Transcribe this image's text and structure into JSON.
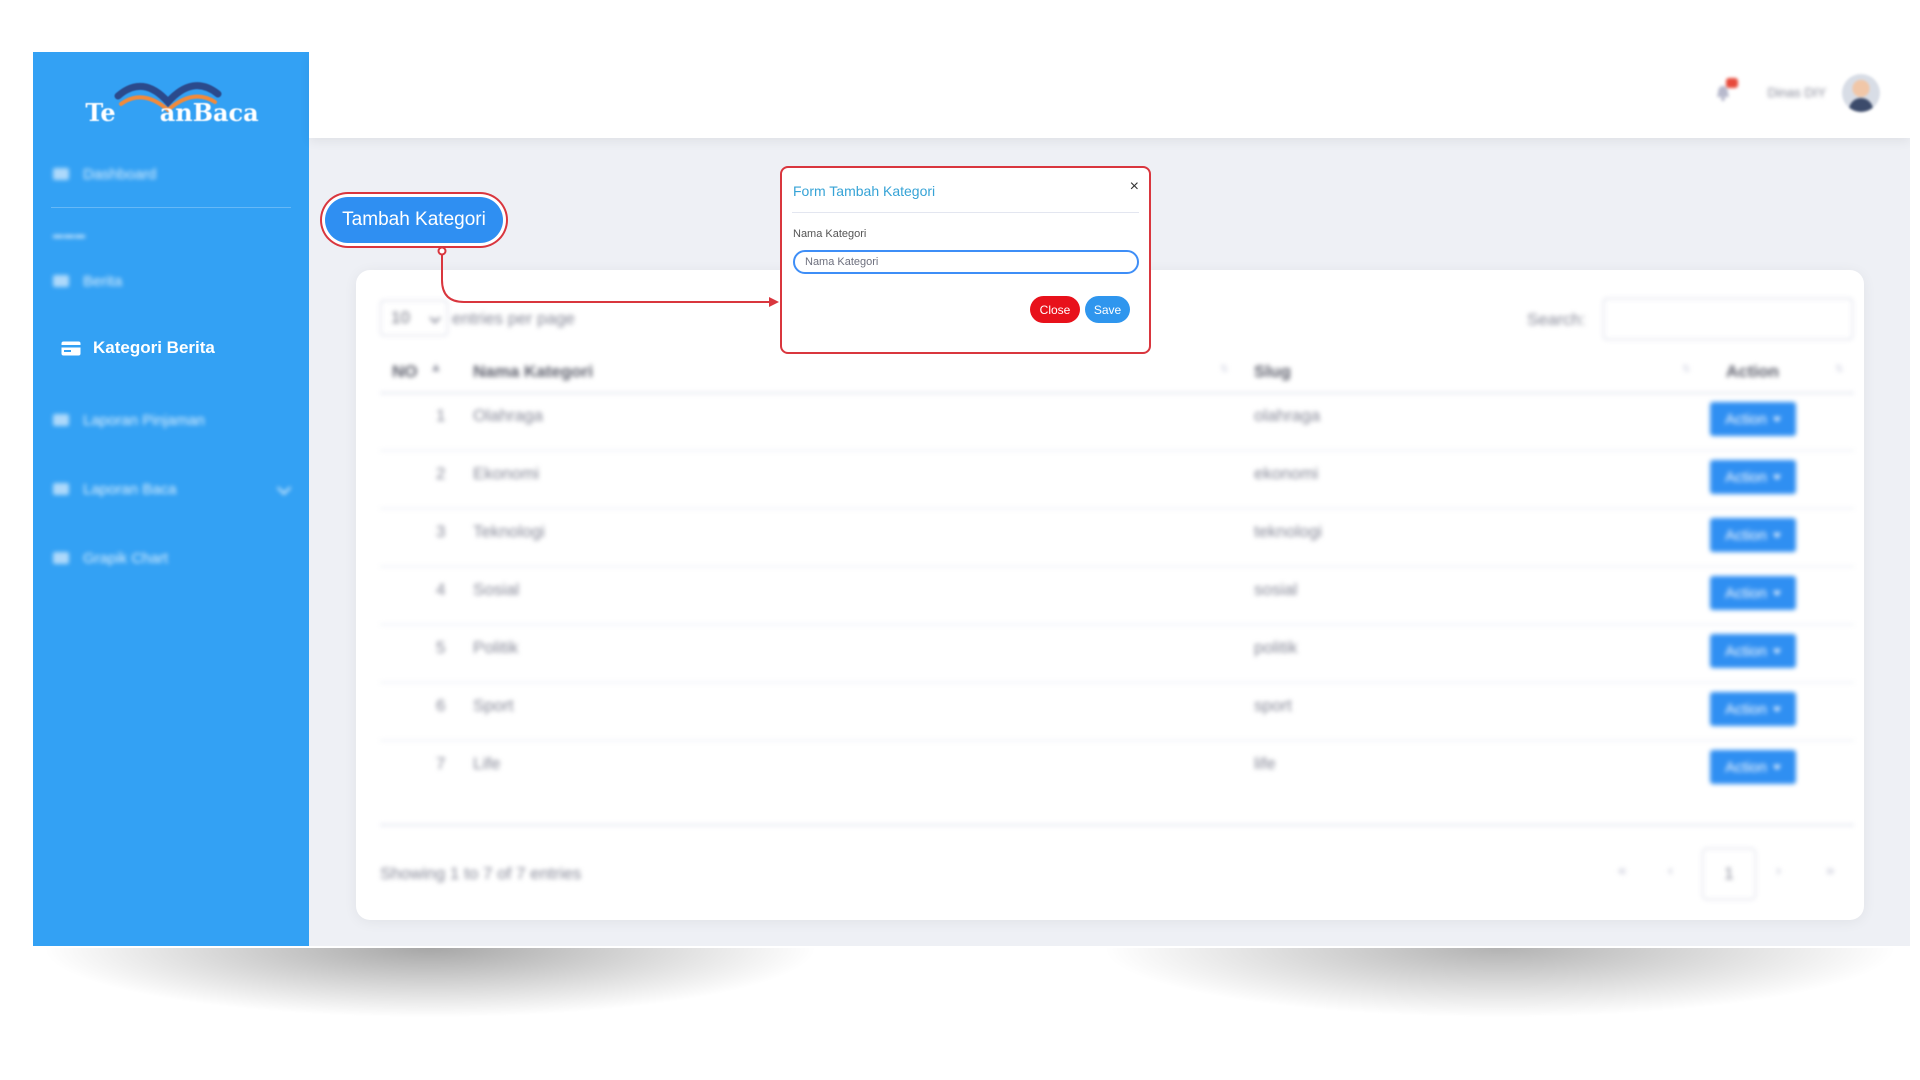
{
  "brand": {
    "name": "TemanBaca",
    "logo_text_left": "Te",
    "logo_text_right": "anBaca"
  },
  "sidebar": {
    "items": [
      {
        "label": "Dashboard",
        "icon": "dashboard-icon"
      },
      {
        "label": "Berita",
        "icon": "newspaper-icon"
      },
      {
        "label": "Kategori Berita",
        "icon": "card-icon",
        "active": true
      },
      {
        "label": "Laporan Pinjaman",
        "icon": "folder-icon"
      },
      {
        "label": "Laporan Baca",
        "icon": "folder-icon"
      },
      {
        "label": "Grapik Chart",
        "icon": "chart-icon"
      }
    ]
  },
  "topbar": {
    "user_name": "Dinas DIY",
    "notification_count": "1"
  },
  "main": {
    "add_button": "Tambah Kategori",
    "entries_value": "10",
    "entries_label": "entries per page",
    "search_label": "Search:",
    "columns": [
      "NO",
      "Nama Kategori",
      "Slug",
      "Action"
    ],
    "rows": [
      {
        "no": "1",
        "name": "Olahraga",
        "slug": "olahraga",
        "action": "Action"
      },
      {
        "no": "2",
        "name": "Ekonomi",
        "slug": "ekonomi",
        "action": "Action"
      },
      {
        "no": "3",
        "name": "Teknologi",
        "slug": "teknologi",
        "action": "Action"
      },
      {
        "no": "4",
        "name": "Sosial",
        "slug": "sosial",
        "action": "Action"
      },
      {
        "no": "5",
        "name": "Politik",
        "slug": "politik",
        "action": "Action"
      },
      {
        "no": "6",
        "name": "Sport",
        "slug": "sport",
        "action": "Action"
      },
      {
        "no": "7",
        "name": "Life",
        "slug": "life",
        "action": "Action"
      }
    ],
    "showing_text": "Showing 1 to 7 of 7 entries",
    "pagination": {
      "first": "«",
      "prev": "‹",
      "current": "1",
      "next": "›",
      "last": "»"
    }
  },
  "modal": {
    "title": "Form Tambah Kategori",
    "close_icon": "×",
    "field_label": "Nama Kategori",
    "field_placeholder": "Nama Kategori",
    "close_button": "Close",
    "save_button": "Save"
  },
  "colors": {
    "sidebar": "#33a1f4",
    "primary": "#2f8ff2",
    "highlight": "#d9363e",
    "danger": "#e8111b"
  }
}
